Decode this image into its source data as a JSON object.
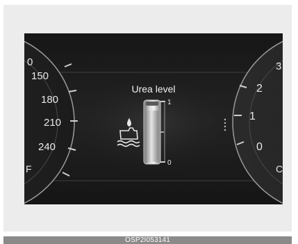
{
  "title": "Urea level",
  "gauge": {
    "scale_max": "1",
    "scale_min": "0",
    "fill_fraction": 0.85
  },
  "speedometer": {
    "ticks": [
      "0",
      "150",
      "180",
      "210",
      "240"
    ],
    "end_mark": "F"
  },
  "tachometer": {
    "ticks": [
      "3",
      "2",
      "1",
      "0"
    ],
    "end_mark": "C"
  },
  "icons": {
    "urea_warning": "urea-tank-icon"
  },
  "caption": "OSP2I053141",
  "colors": {
    "screen": "#1a1a1a",
    "text": "#e8e8e8",
    "tube": "#cfcfcf",
    "accent": "#cccccc"
  }
}
